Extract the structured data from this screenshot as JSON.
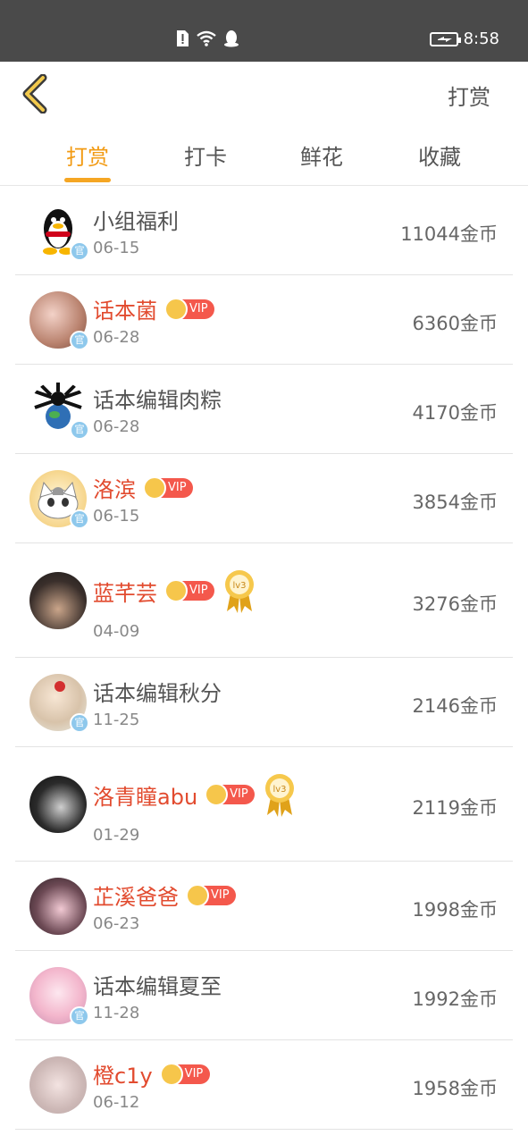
{
  "status_bar": {
    "time": "8:58"
  },
  "nav": {
    "action_label": "打赏"
  },
  "tabs": [
    {
      "label": "打赏",
      "active": true
    },
    {
      "label": "打卡",
      "active": false
    },
    {
      "label": "鲜花",
      "active": false
    },
    {
      "label": "收藏",
      "active": false
    }
  ],
  "vip_label": "VIP",
  "official_label": "官",
  "level_label": "lv3",
  "list": [
    {
      "name": "小组福利",
      "date": "06-15",
      "amount": "11044金币",
      "vip": false,
      "official": true,
      "level": false
    },
    {
      "name": "话本菌",
      "date": "06-28",
      "amount": "6360金币",
      "vip": true,
      "official": true,
      "level": false
    },
    {
      "name": "话本编辑肉粽",
      "date": "06-28",
      "amount": "4170金币",
      "vip": false,
      "official": true,
      "level": false
    },
    {
      "name": "洛滨",
      "date": "06-15",
      "amount": "3854金币",
      "vip": true,
      "official": true,
      "level": false
    },
    {
      "name": "蓝芊芸",
      "date": "04-09",
      "amount": "3276金币",
      "vip": true,
      "official": false,
      "level": true
    },
    {
      "name": "话本编辑秋分",
      "date": "11-25",
      "amount": "2146金币",
      "vip": false,
      "official": true,
      "level": false
    },
    {
      "name": "洛青瞳abu",
      "date": "01-29",
      "amount": "2119金币",
      "vip": true,
      "official": false,
      "level": true
    },
    {
      "name": "芷溪爸爸",
      "date": "06-23",
      "amount": "1998金币",
      "vip": true,
      "official": false,
      "level": false
    },
    {
      "name": "话本编辑夏至",
      "date": "11-28",
      "amount": "1992金币",
      "vip": false,
      "official": true,
      "level": false
    },
    {
      "name": "橙c1y",
      "date": "06-12",
      "amount": "1958金币",
      "vip": true,
      "official": false,
      "level": false
    }
  ]
}
